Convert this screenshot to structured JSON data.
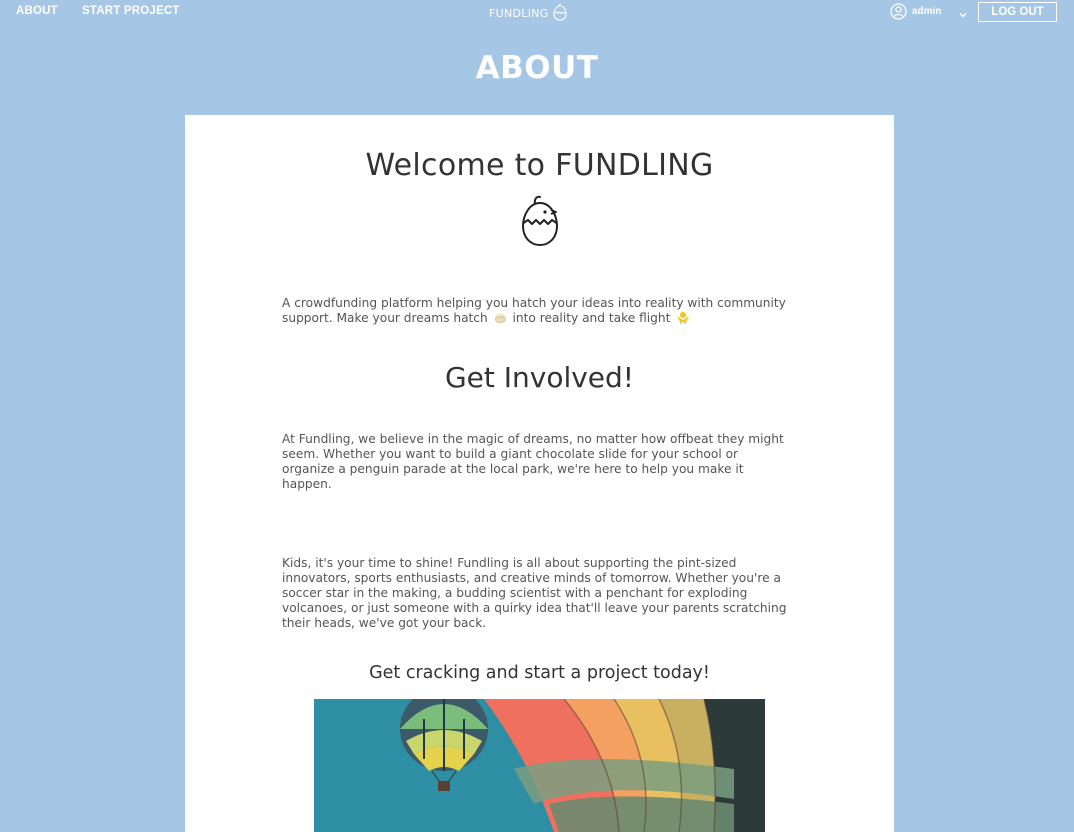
{
  "nav": {
    "about_label": "ABOUT",
    "start_project_label": "START PROJECT",
    "brand_name": "FUNDLING",
    "brand_icon": "hatching-chick-icon",
    "user_icon": "user-circle-icon",
    "username": "admin",
    "dropdown_icon": "chevron-down-icon",
    "logout_label": "LOG OUT"
  },
  "page": {
    "title": "ABOUT"
  },
  "content": {
    "welcome_heading": "Welcome to FUNDLING",
    "intro_part1": "A crowdfunding platform helping you hatch your ideas into reality with community support. Make your dreams hatch",
    "intro_part2": "into reality and take flight",
    "get_involved_heading": "Get Involved!",
    "paragraph1": "At Fundling, we believe in the magic of dreams, no matter how offbeat they might seem. Whether you want to build a giant chocolate slide for your school or organize a penguin parade at the local park, we're here to help you make it happen.",
    "paragraph2": "Kids, it's your time to shine! Fundling is all about supporting the pint-sized innovators, sports enthusiasts, and creative minds of tomorrow. Whether you're a soccer star in the making, a budding scientist with a penchant for exploding volcanoes, or just someone with a quirky idea that'll leave your parents scratching their heads, we've got your back.",
    "cta_heading": "Get cracking and start a project today!",
    "hero_image": "hot-air-balloons-photo"
  },
  "colors": {
    "background": "#a5c6e5",
    "card": "#ffffff",
    "text": "#555555"
  }
}
